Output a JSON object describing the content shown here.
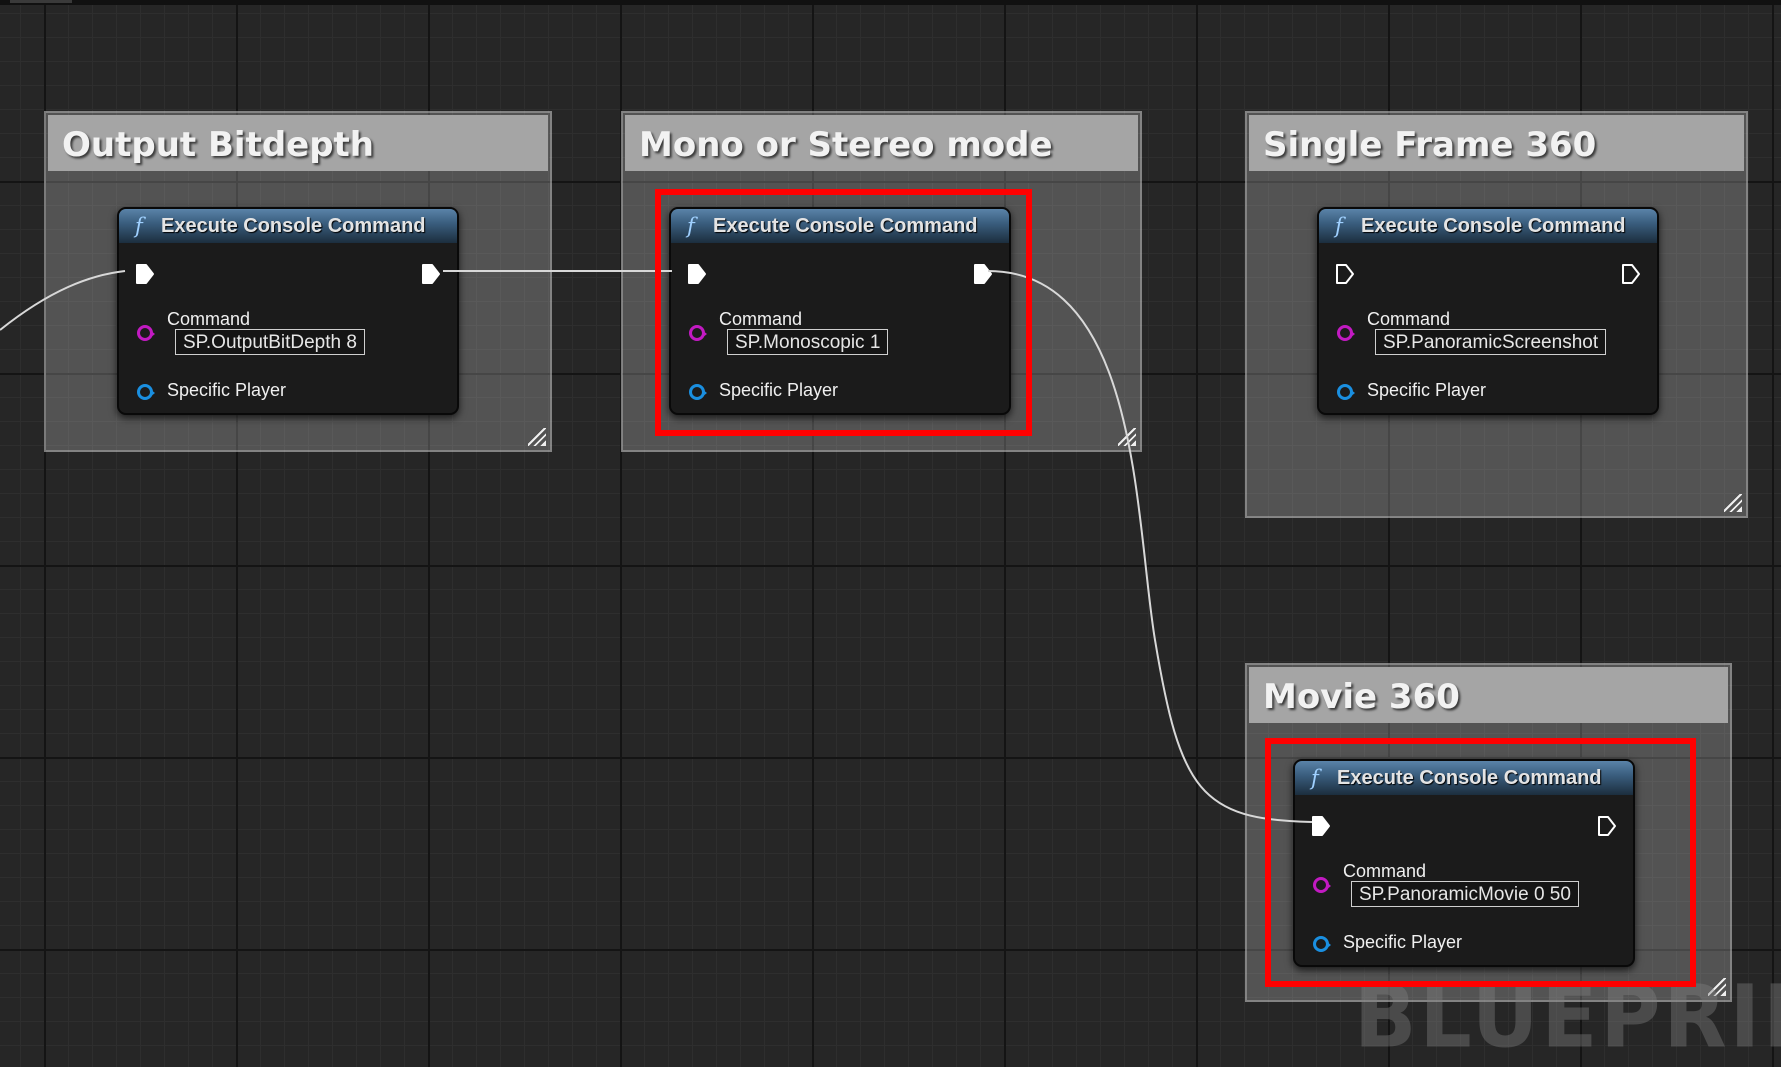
{
  "graph": {
    "watermark": "BLUEPRINT",
    "comments": [
      {
        "title": "Output Bitdepth"
      },
      {
        "title": "Mono or Stereo mode"
      },
      {
        "title": "Single Frame 360"
      },
      {
        "title": "Movie 360"
      }
    ],
    "nodes": [
      {
        "title": "Execute Console Command",
        "command_label": "Command",
        "command_value": "SP.OutputBitDepth 8",
        "player_label": "Specific Player"
      },
      {
        "title": "Execute Console Command",
        "command_label": "Command",
        "command_value": "SP.Monoscopic 1",
        "player_label": "Specific Player"
      },
      {
        "title": "Execute Console Command",
        "command_label": "Command",
        "command_value": "SP.PanoramicScreenshot",
        "player_label": "Specific Player"
      },
      {
        "title": "Execute Console Command",
        "command_label": "Command",
        "command_value": "SP.PanoramicMovie 0 50",
        "player_label": "Specific Player"
      }
    ],
    "function_icon": "f",
    "pin_colors": {
      "exec": "#ffffff",
      "command": "#c21ac2",
      "player": "#1a8fe0",
      "wire": "#d8d8d8"
    },
    "highlight_color": "#ff0000"
  }
}
